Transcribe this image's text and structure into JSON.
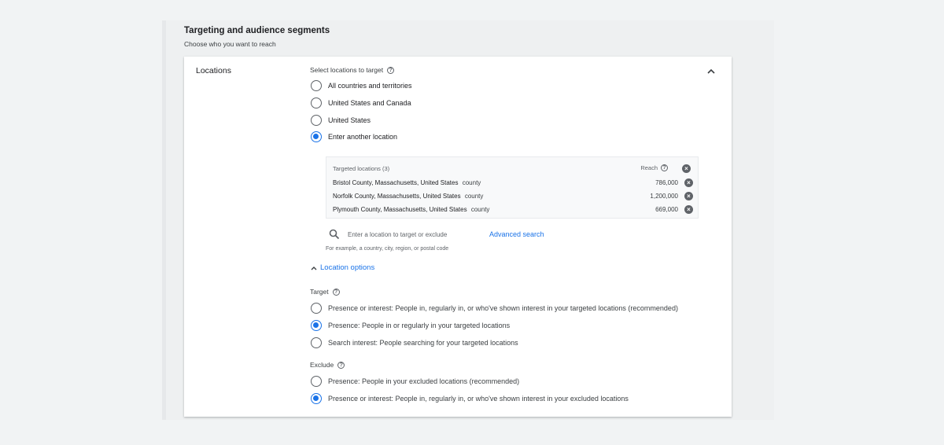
{
  "section": {
    "title": "Targeting and audience segments",
    "subtitle": "Choose who you want to reach"
  },
  "locations_card": {
    "label": "Locations",
    "select_label": "Select locations to target",
    "options": [
      {
        "label": "All countries and territories",
        "selected": false
      },
      {
        "label": "United States and Canada",
        "selected": false
      },
      {
        "label": "United States",
        "selected": false
      },
      {
        "label": "Enter another location",
        "selected": true
      }
    ],
    "targeted": {
      "header": "Targeted locations (3)",
      "reach_header": "Reach",
      "rows": [
        {
          "name": "Bristol County, Massachusetts, United States",
          "type": "county",
          "reach": "786,000"
        },
        {
          "name": "Norfolk County, Massachusetts, United States",
          "type": "county",
          "reach": "1,200,000"
        },
        {
          "name": "Plymouth County, Massachusetts, United States",
          "type": "county",
          "reach": "669,000"
        }
      ]
    },
    "search": {
      "placeholder": "Enter a location to target or exclude",
      "advanced_label": "Advanced search",
      "hint": "For example, a country, city, region, or postal code"
    },
    "location_options_label": "Location options",
    "target": {
      "label": "Target",
      "options": [
        {
          "label": "Presence or interest: People in, regularly in, or who've shown interest in your targeted locations (recommended)",
          "selected": false
        },
        {
          "label": "Presence: People in or regularly in your targeted locations",
          "selected": true
        },
        {
          "label": "Search interest: People searching for your targeted locations",
          "selected": false
        }
      ]
    },
    "exclude": {
      "label": "Exclude",
      "options": [
        {
          "label": "Presence: People in your excluded locations (recommended)",
          "selected": false
        },
        {
          "label": "Presence or interest: People in, regularly in, or who've shown interest in your excluded locations",
          "selected": true
        }
      ]
    }
  },
  "colors": {
    "accent": "#1a73e8",
    "text": "#202124",
    "background": "#f1f3f4"
  },
  "icons": {
    "collapse": "chevron-up-icon",
    "help": "help-circle-icon",
    "remove": "close-circle-icon",
    "search": "search-icon"
  }
}
